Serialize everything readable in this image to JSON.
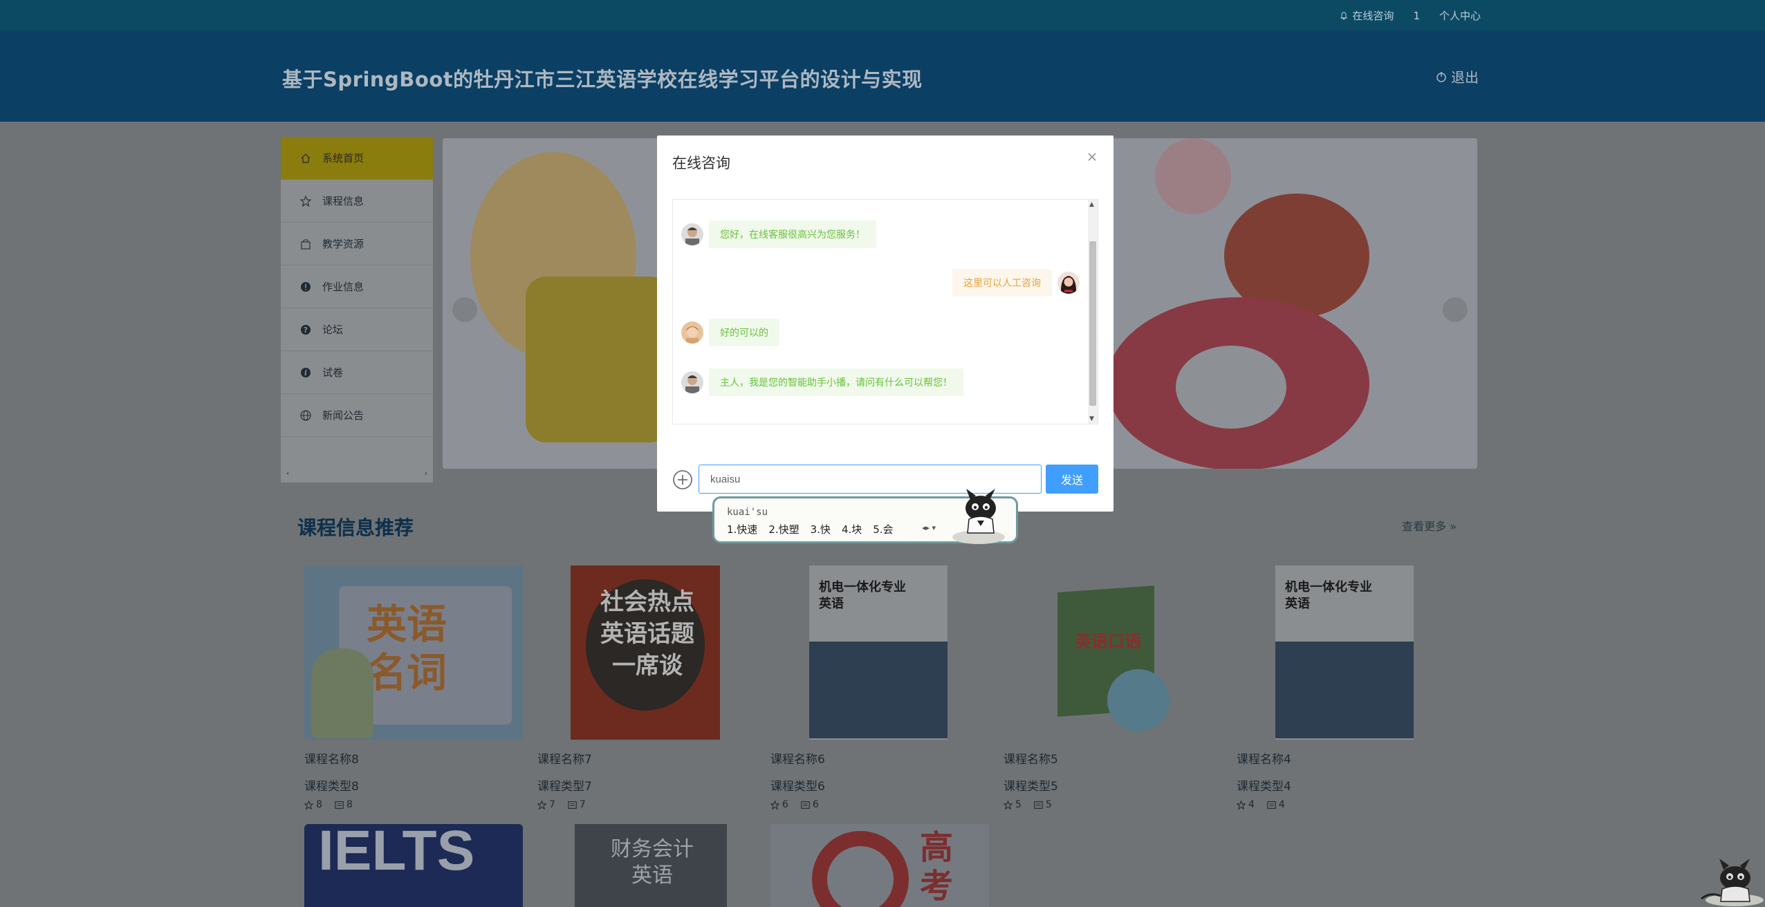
{
  "topbar": {
    "consult_label": "在线咨询",
    "badge_count": "1",
    "profile_label": "个人中心"
  },
  "header": {
    "title": "基于SpringBoot的牡丹江市三江英语学校在线学习平台的设计与实现",
    "logout_label": "退出"
  },
  "sidebar": {
    "items": [
      {
        "label": "系统首页",
        "icon": "home-icon"
      },
      {
        "label": "课程信息",
        "icon": "star-icon"
      },
      {
        "label": "教学资源",
        "icon": "bag-icon"
      },
      {
        "label": "作业信息",
        "icon": "alert-icon"
      },
      {
        "label": "论坛",
        "icon": "question-icon"
      },
      {
        "label": "试卷",
        "icon": "info-icon"
      },
      {
        "label": "新闻公告",
        "icon": "globe-icon"
      }
    ]
  },
  "section": {
    "title": "课程信息推荐",
    "more_label": "查看更多 »",
    "courses": [
      {
        "name": "课程名称8",
        "type": "课程类型8",
        "likes": "8",
        "comments": "8",
        "cover_text": "英语名词"
      },
      {
        "name": "课程名称7",
        "type": "课程类型7",
        "likes": "7",
        "comments": "7",
        "cover_text": "社会热点英语话题一席谈"
      },
      {
        "name": "课程名称6",
        "type": "课程类型6",
        "likes": "6",
        "comments": "6",
        "cover_text": "机电一体化专业英语"
      },
      {
        "name": "课程名称5",
        "type": "课程类型5",
        "likes": "5",
        "comments": "5",
        "cover_text": "英语口语"
      },
      {
        "name": "课程名称4",
        "type": "课程类型4",
        "likes": "4",
        "comments": "4",
        "cover_text": "机电一体化专业英语"
      }
    ],
    "row2_covers": [
      "IELTS",
      "财务会计英语",
      "高考"
    ]
  },
  "modal": {
    "title": "在线咨询",
    "messages": [
      {
        "side": "left",
        "text": "您好，在线客服很高兴为您服务！"
      },
      {
        "side": "right",
        "text": "这里可以人工咨询"
      },
      {
        "side": "left",
        "text": "好的可以的"
      },
      {
        "side": "left",
        "text": "主人，我是您的智能助手小播，请问有什么可以帮您！"
      }
    ],
    "input_value": "kuaisu",
    "send_label": "发送"
  },
  "ime": {
    "composition": "kuai'su",
    "candidates": [
      "1.快速",
      "2.快塑",
      "3.快",
      "4.块",
      "5.会"
    ]
  },
  "colors": {
    "accent": "#409eff",
    "bubble_left_text": "#67c23a",
    "bubble_right_text": "#e6a23c",
    "header_bg": "#0b3f63"
  }
}
